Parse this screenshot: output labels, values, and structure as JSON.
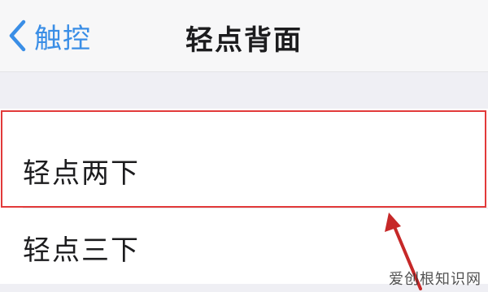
{
  "nav": {
    "back_label": "触控",
    "title": "轻点背面"
  },
  "list": {
    "items": [
      {
        "label": "轻点两下",
        "highlighted": true
      },
      {
        "label": "轻点三下",
        "highlighted": false
      }
    ]
  },
  "annotation": {
    "highlight_color": "#e23a3a",
    "arrow_color": "#c62828"
  },
  "colors": {
    "accent": "#3a8ee6",
    "background": "#efeff4"
  },
  "watermark": {
    "text": "爱创根知识网"
  }
}
